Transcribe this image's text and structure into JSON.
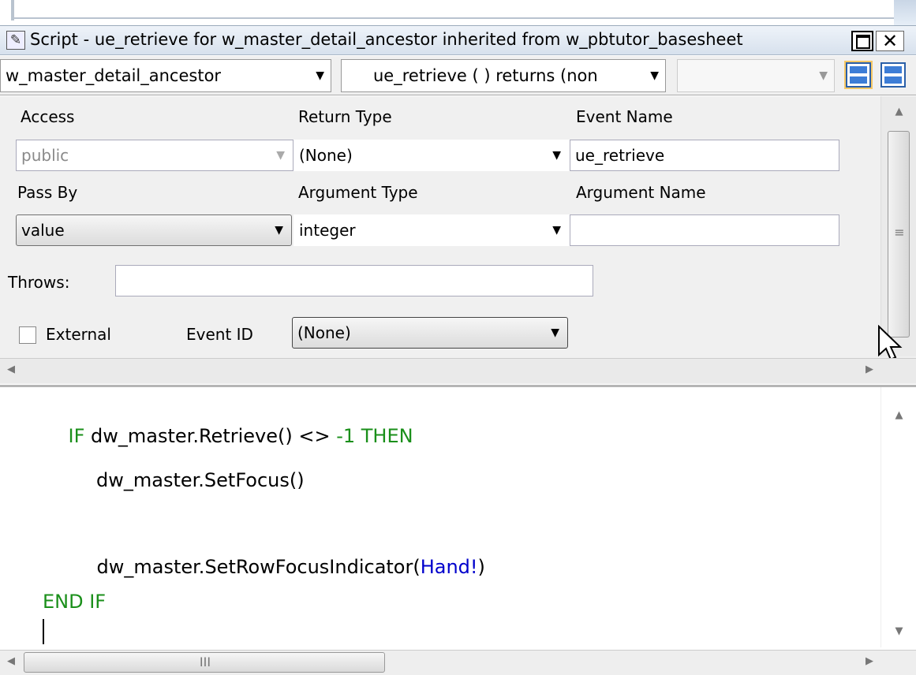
{
  "window": {
    "title": "Script - ue_retrieve for w_master_detail_ancestor inherited from w_pbtutor_basesheet"
  },
  "selectors": {
    "object": "w_master_detail_ancestor",
    "event": "ue_retrieve ( ) returns (non",
    "extra": ""
  },
  "properties": {
    "access_label": "Access",
    "access_value": "public",
    "return_type_label": "Return Type",
    "return_type_value": "(None)",
    "event_name_label": "Event Name",
    "event_name_value": "ue_retrieve",
    "pass_by_label": "Pass By",
    "pass_by_value": "value",
    "argument_type_label": "Argument Type",
    "argument_type_value": "integer",
    "argument_name_label": "Argument Name",
    "argument_name_value": "",
    "throws_label": "Throws:",
    "throws_value": "",
    "external_label": "External",
    "external_checked": false,
    "event_id_label": "Event ID",
    "event_id_value": "(None)"
  },
  "code": {
    "line1_kw": "IF",
    "line1_text": " dw_master.Retrieve() <> ",
    "line1_num": "-1",
    "line1_then": " THEN",
    "line2": "dw_master.SetFocus()",
    "line3_text": "dw_master.SetRowFocusIndicator(",
    "line3_enum": "Hand!",
    "line3_close": ")",
    "line4": "END IF"
  },
  "icons": {
    "app": "script-icon",
    "restore": "restore-icon",
    "close": "close-icon",
    "layout1": "horizontal-split-icon",
    "layout2": "vertical-split-icon"
  },
  "colors": {
    "keyword": "#1a8f1a",
    "enum": "#0000cc",
    "accent": "#3d7dd6"
  }
}
